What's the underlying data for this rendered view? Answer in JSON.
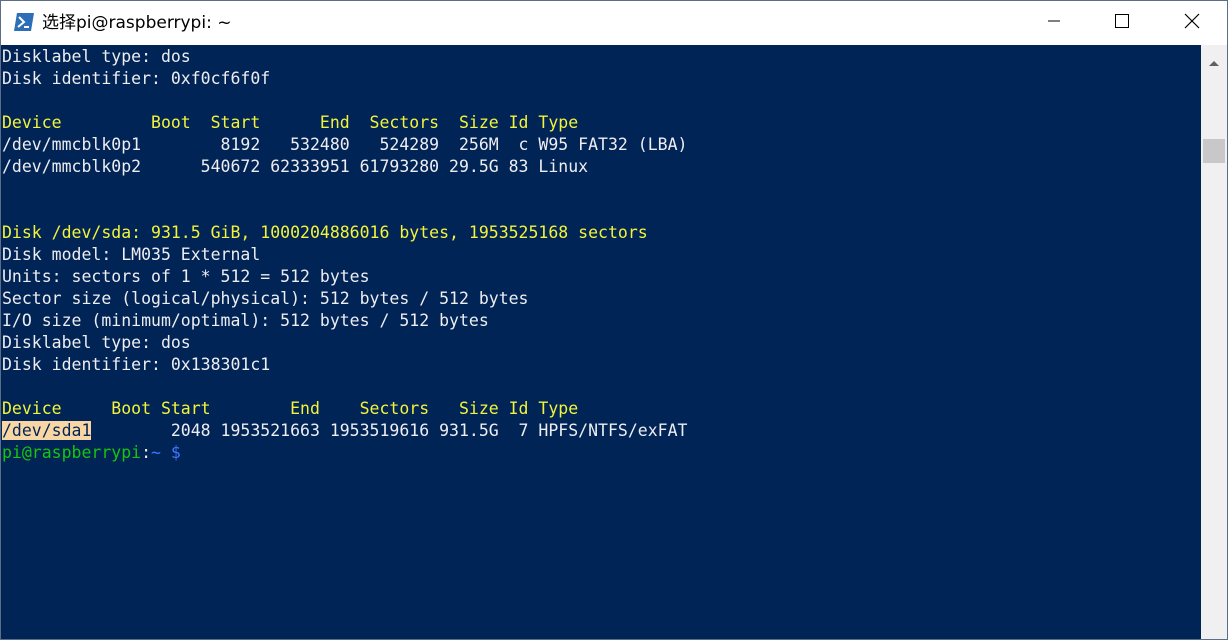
{
  "window": {
    "title": "选择pi@raspberrypi: ~",
    "colors": {
      "background": "#012456",
      "default_text": "#eeedf0",
      "yellow_text": "#f3f43a",
      "green_text": "#16c60c",
      "blue_text": "#3b78ff",
      "selection": "#f9d7a5"
    },
    "icons": {
      "app": "powershell-icon",
      "minimize": "minimize-icon",
      "maximize": "maximize-icon",
      "close": "close-icon",
      "scroll_up": "chevron-up-icon"
    }
  },
  "terminal": {
    "line01": "Disklabel type: dos",
    "line02": "Disk identifier: 0xf0cf6f0f",
    "table1_header": "Device         Boot  Start      End  Sectors  Size Id Type",
    "table1_row1": "/dev/mmcblk0p1        8192   532480   524289  256M  c W95 FAT32 (LBA)",
    "table1_row2": "/dev/mmcblk0p2      540672 62333951 61793280 29.5G 83 Linux",
    "disk_header": "Disk /dev/sda: 931.5 GiB, 1000204886016 bytes, 1953525168 sectors",
    "disk_model": "Disk model: LM035 External",
    "units": "Units: sectors of 1 * 512 = 512 bytes",
    "sector_size": "Sector size (logical/physical): 512 bytes / 512 bytes",
    "io_size": "I/O size (minimum/optimal): 512 bytes / 512 bytes",
    "disklabel2": "Disklabel type: dos",
    "identifier2": "Disk identifier: 0x138301c1",
    "table2_header": "Device     Boot Start        End    Sectors   Size Id Type",
    "table2_row1_device": "/dev/sda1",
    "table2_row1_rest": "        2048 1953521663 1953519616 931.5G  7 HPFS/NTFS/exFAT",
    "prompt_user": "pi@raspberrypi",
    "prompt_colon": ":",
    "prompt_path": "~",
    "prompt_dollar": " $"
  }
}
